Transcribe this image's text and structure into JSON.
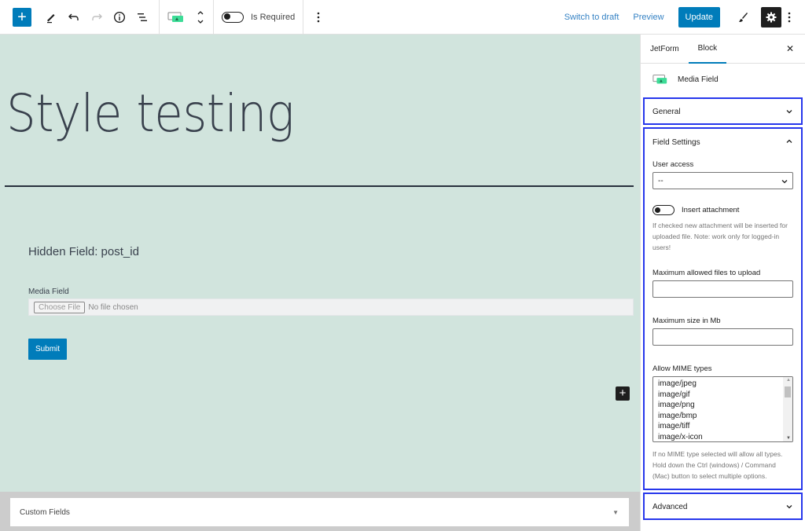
{
  "toolbar": {
    "add_block": "+",
    "is_required_label": "Is Required",
    "switch_to_draft": "Switch to draft",
    "preview": "Preview",
    "update": "Update"
  },
  "canvas": {
    "title": "Style testing",
    "hidden_field": "Hidden Field: post_id",
    "media_label": "Media Field",
    "choose_file": "Choose File",
    "no_file": "No file chosen",
    "submit": "Submit",
    "add_block": "+"
  },
  "metabox": {
    "title": "Custom Fields",
    "arrow": "▼"
  },
  "sidebar": {
    "tabs": [
      {
        "label": "JetForm",
        "active": false
      },
      {
        "label": "Block",
        "active": true
      }
    ],
    "close": "✕",
    "block_name": "Media Field",
    "panels": {
      "general": "General",
      "field_settings": "Field Settings",
      "advanced": "Advanced"
    },
    "user_access": {
      "label": "User access",
      "value": "--"
    },
    "insert_attachment": {
      "label": "Insert attachment",
      "help": "If checked new attachment will be inserted for uploaded file. Note: work only for logged-in users!"
    },
    "max_files": {
      "label": "Maximum allowed files to upload",
      "value": ""
    },
    "max_size": {
      "label": "Maximum size in Mb",
      "value": ""
    },
    "mime": {
      "label": "Allow MIME types",
      "options": [
        "image/jpeg",
        "image/gif",
        "image/png",
        "image/bmp",
        "image/tiff",
        "image/x-icon"
      ],
      "help": "If no MIME type selected will allow all types. Hold down the Ctrl (windows) / Command (Mac) button to select multiple options."
    }
  },
  "colors": {
    "accent": "#007cba",
    "canvas_bg": "#d1e4dd",
    "highlight_border": "#2737ec",
    "block_icon": "#3ddc97"
  }
}
